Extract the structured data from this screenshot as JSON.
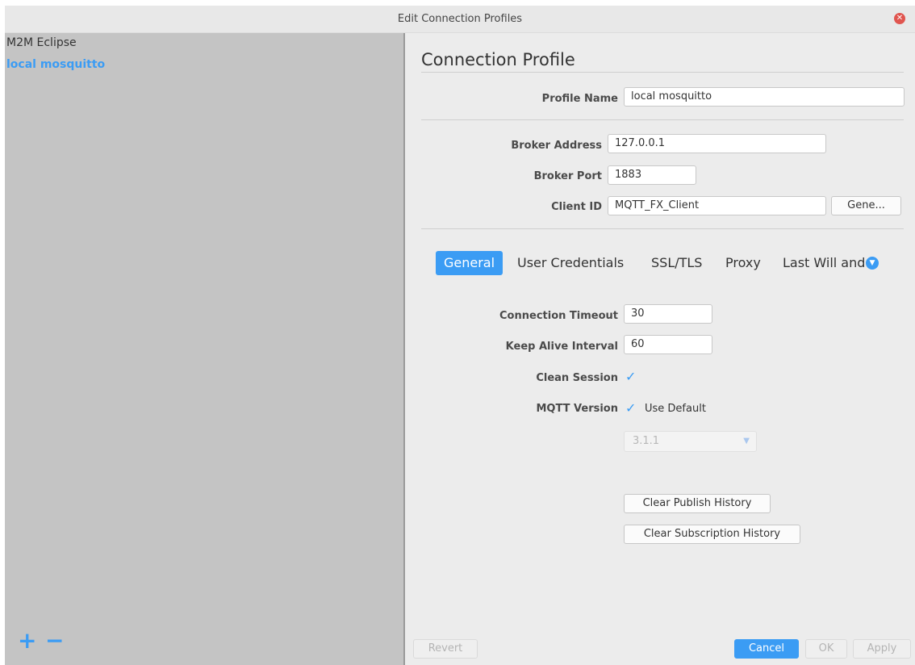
{
  "window": {
    "title": "Edit Connection Profiles"
  },
  "profiles": [
    {
      "name": "M2M Eclipse",
      "selected": false
    },
    {
      "name": "local mosquitto",
      "selected": true
    }
  ],
  "sidebar_actions": {
    "add": "+",
    "remove": "−"
  },
  "form": {
    "heading": "Connection Profile",
    "profile_name_label": "Profile Name",
    "profile_name_value": "local mosquitto",
    "broker_address_label": "Broker Address",
    "broker_address_value": "127.0.0.1",
    "broker_port_label": "Broker Port",
    "broker_port_value": "1883",
    "client_id_label": "Client ID",
    "client_id_value": "MQTT_FX_Client",
    "generate_button": "Gene..."
  },
  "tabs": [
    {
      "label": "General",
      "active": true
    },
    {
      "label": "User Credentials",
      "active": false
    },
    {
      "label": "SSL/TLS",
      "active": false
    },
    {
      "label": "Proxy",
      "active": false
    },
    {
      "label": "Last Will and T",
      "active": false
    }
  ],
  "general": {
    "connection_timeout_label": "Connection Timeout",
    "connection_timeout_value": "30",
    "keep_alive_label": "Keep Alive Interval",
    "keep_alive_value": "60",
    "clean_session_label": "Clean Session",
    "clean_session_checked": true,
    "mqtt_version_label": "MQTT Version",
    "use_default_label": "Use Default",
    "use_default_checked": true,
    "version_select_value": "3.1.1",
    "clear_publish_button": "Clear Publish History",
    "clear_subscription_button": "Clear Subscription History"
  },
  "footer": {
    "revert": "Revert",
    "cancel": "Cancel",
    "ok": "OK",
    "apply": "Apply"
  },
  "colors": {
    "accent": "#3b9cf4",
    "sidebar_bg": "#c4c4c4",
    "panel_bg": "#ececec",
    "close": "#e0554f"
  },
  "icons": {
    "close": "close-icon",
    "checkmark": "checkmark-icon",
    "chevron": "chevron-down-icon"
  }
}
